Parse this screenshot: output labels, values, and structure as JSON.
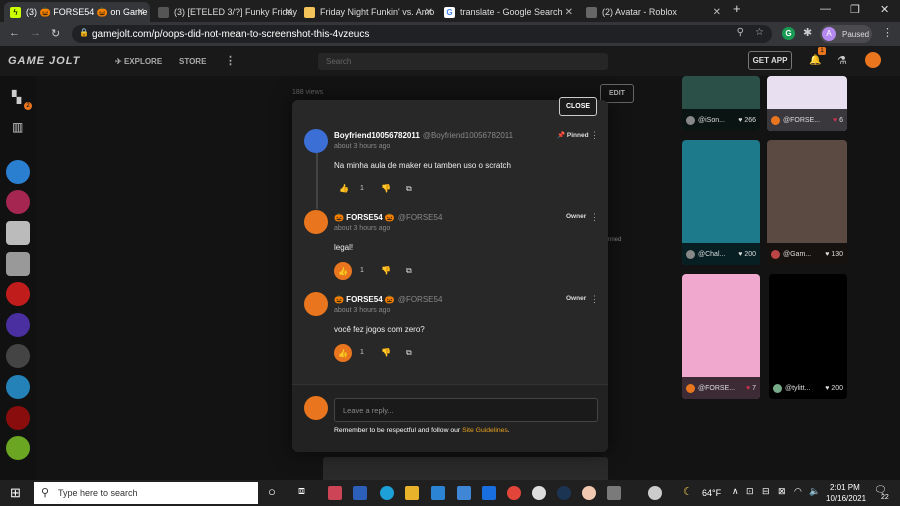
{
  "browser": {
    "tabs": [
      {
        "label": "(3) 🎃 FORSE54 🎃 on Game",
        "active": true
      },
      {
        "label": "(3) [ETELED 3/?] Funky Friday",
        "active": false
      },
      {
        "label": "Friday Night Funkin' vs. Amo",
        "active": false
      },
      {
        "label": "translate - Google Search",
        "active": false
      },
      {
        "label": "(2) Avatar - Roblox",
        "active": false
      }
    ],
    "new_tab": "+",
    "url": "gamejolt.com/p/oops-did-not-mean-to-screenshot-this-4vzeucs",
    "profile_label": "Paused",
    "profile_initial": "A",
    "extension_initial": "G"
  },
  "site": {
    "logo": "GAME JOLT",
    "nav": {
      "explore": "EXPLORE",
      "store": "STORE"
    },
    "search_placeholder": "Search",
    "get_app": "GET APP",
    "notification_count": "1",
    "sidebar_badge": "2"
  },
  "background": {
    "views": "188 views",
    "edit": "EDIT",
    "pinned_fragment": "nned",
    "thumbs": [
      {
        "user": "@iSon...",
        "count": "266"
      },
      {
        "user": "@FORSE...",
        "count": "6"
      },
      {
        "user": "@Chal...",
        "count": "200"
      },
      {
        "user": "@Gam...",
        "count": "130"
      },
      {
        "user": "@FORSE...",
        "count": "7"
      },
      {
        "user": "@tylitt...",
        "count": "200"
      }
    ]
  },
  "modal": {
    "close": "CLOSE",
    "comments": [
      {
        "name": "Boyfriend10056782011",
        "handle": "@Boyfriend10056782011",
        "time": "about 3 hours ago",
        "tag": "Pinned",
        "text": "Na minha aula de maker eu tamben uso o scratch",
        "likes": "1",
        "liked": false
      },
      {
        "name": "🎃 FORSE54 🎃",
        "handle": "@FORSE54",
        "time": "about 3 hours ago",
        "tag": "Owner",
        "text": "legal!",
        "likes": "1",
        "liked": true
      },
      {
        "name": "🎃 FORSE54 🎃",
        "handle": "@FORSE54",
        "time": "about 3 hours ago",
        "tag": "Owner",
        "text": "você fez jogos com zero?",
        "likes": "1",
        "liked": true
      }
    ],
    "reply_placeholder": "Leave a reply...",
    "guideline_text": "Remember to be respectful and follow our ",
    "guideline_link": "Site Guidelines",
    "guideline_end": "."
  },
  "taskbar": {
    "search_placeholder": "Type here to search",
    "weather": "64°F",
    "time": "2:01 PM",
    "date": "10/16/2021",
    "notifications": "22"
  }
}
